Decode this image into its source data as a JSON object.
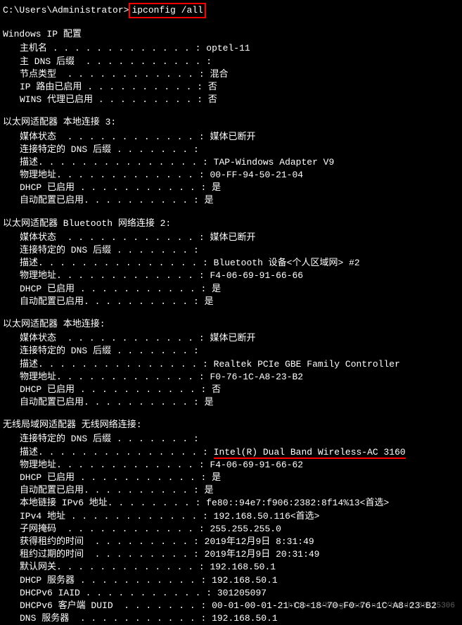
{
  "prompt": {
    "path": "C:\\Users\\Administrator>",
    "command": "ipconfig /all"
  },
  "sections": {
    "ipconfig_header": "Windows IP 配置",
    "ipconfig_items": [
      {
        "label": "主机名",
        "dots": " . . . . . . . . . . . . . ",
        "value": "optel-11"
      },
      {
        "label": "主 DNS 后缀",
        "dots": "  . . . . . . . . . . . ",
        "value": ""
      },
      {
        "label": "节点类型",
        "dots": "  . . . . . . . . . . . . ",
        "value": "混合"
      },
      {
        "label": "IP 路由已启用",
        "dots": " . . . . . . . . . . ",
        "value": "否"
      },
      {
        "label": "WINS 代理已启用",
        "dots": " . . . . . . . . . ",
        "value": "否"
      }
    ],
    "adapter1_header": "以太网适配器 本地连接 3:",
    "adapter1_items": [
      {
        "label": "媒体状态",
        "dots": "  . . . . . . . . . . . . ",
        "value": "媒体已断开"
      },
      {
        "label": "连接特定的 DNS 后缀",
        "dots": " . . . . . . . ",
        "value": ""
      },
      {
        "label": "描述.",
        "dots": " . . . . . . . . . . . . . . ",
        "value": "TAP-Windows Adapter V9"
      },
      {
        "label": "物理地址.",
        "dots": " . . . . . . . . . . . . ",
        "value": "00-FF-94-50-21-04"
      },
      {
        "label": "DHCP 已启用",
        "dots": " . . . . . . . . . . . ",
        "value": "是"
      },
      {
        "label": "自动配置已启用.",
        "dots": " . . . . . . . . . ",
        "value": "是"
      }
    ],
    "adapter2_header": "以太网适配器 Bluetooth 网络连接 2:",
    "adapter2_items": [
      {
        "label": "媒体状态",
        "dots": "  . . . . . . . . . . . . ",
        "value": "媒体已断开"
      },
      {
        "label": "连接特定的 DNS 后缀",
        "dots": " . . . . . . . ",
        "value": ""
      },
      {
        "label": "描述.",
        "dots": " . . . . . . . . . . . . . . ",
        "value": "Bluetooth 设备<个人区域网> #2"
      },
      {
        "label": "物理地址.",
        "dots": " . . . . . . . . . . . . ",
        "value": "F4-06-69-91-66-66"
      },
      {
        "label": "DHCP 已启用",
        "dots": " . . . . . . . . . . . ",
        "value": "是"
      },
      {
        "label": "自动配置已启用.",
        "dots": " . . . . . . . . . ",
        "value": "是"
      }
    ],
    "adapter3_header": "以太网适配器 本地连接:",
    "adapter3_items": [
      {
        "label": "媒体状态",
        "dots": "  . . . . . . . . . . . . ",
        "value": "媒体已断开"
      },
      {
        "label": "连接特定的 DNS 后缀",
        "dots": " . . . . . . . ",
        "value": ""
      },
      {
        "label": "描述.",
        "dots": " . . . . . . . . . . . . . . ",
        "value": "Realtek PCIe GBE Family Controller"
      },
      {
        "label": "物理地址.",
        "dots": " . . . . . . . . . . . . ",
        "value": "F0-76-1C-A8-23-B2"
      },
      {
        "label": "DHCP 已启用",
        "dots": " . . . . . . . . . . . ",
        "value": "否"
      },
      {
        "label": "自动配置已启用.",
        "dots": " . . . . . . . . . ",
        "value": "是"
      }
    ],
    "adapter4_header": "无线局域网适配器 无线网络连接:",
    "adapter4_items": [
      {
        "label": "连接特定的 DNS 后缀",
        "dots": " . . . . . . . ",
        "value": ""
      },
      {
        "label": "描述.",
        "dots": " . . . . . . . . . . . . . . ",
        "value": "Intel(R) Dual Band Wireless-AC 3160",
        "underline": true
      },
      {
        "label": "物理地址.",
        "dots": " . . . . . . . . . . . . ",
        "value": "F4-06-69-91-66-62"
      },
      {
        "label": "DHCP 已启用",
        "dots": " . . . . . . . . . . . ",
        "value": "是"
      },
      {
        "label": "自动配置已启用.",
        "dots": " . . . . . . . . . ",
        "value": "是"
      },
      {
        "label": "本地链接 IPv6 地址.",
        "dots": " . . . . . . . ",
        "value": "fe80::94e7:f906:2382:8f14%13<首选>"
      },
      {
        "label": "IPv4 地址",
        "dots": " . . . . . . . . . . . . ",
        "value": "192.168.50.116<首选>"
      },
      {
        "label": "子网掩码",
        "dots": "  . . . . . . . . . . . . ",
        "value": "255.255.255.0"
      },
      {
        "label": "获得租约的时间",
        "dots": "  . . . . . . . . . ",
        "value": "2019年12月9日 8:31:49"
      },
      {
        "label": "租约过期的时间",
        "dots": "  . . . . . . . . . ",
        "value": "2019年12月9日 20:31:49"
      },
      {
        "label": "默认网关.",
        "dots": " . . . . . . . . . . . . ",
        "value": "192.168.50.1"
      },
      {
        "label": "DHCP 服务器",
        "dots": " . . . . . . . . . . . ",
        "value": "192.168.50.1"
      },
      {
        "label": "DHCPv6 IAID",
        "dots": " . . . . . . . . . . . ",
        "value": "301205097"
      },
      {
        "label": "DHCPv6 客户端 DUID",
        "dots": "  . . . . . . . ",
        "value": "00-01-00-01-21-C8-18-70-F0-76-1C-A8-23-B2"
      },
      {
        "label": "DNS 服务器",
        "dots": "  . . . . . . . . . . . ",
        "value": "192.168.50.1"
      }
    ]
  },
  "watermark": "https://blog.csdn.net/baidu_38115306"
}
